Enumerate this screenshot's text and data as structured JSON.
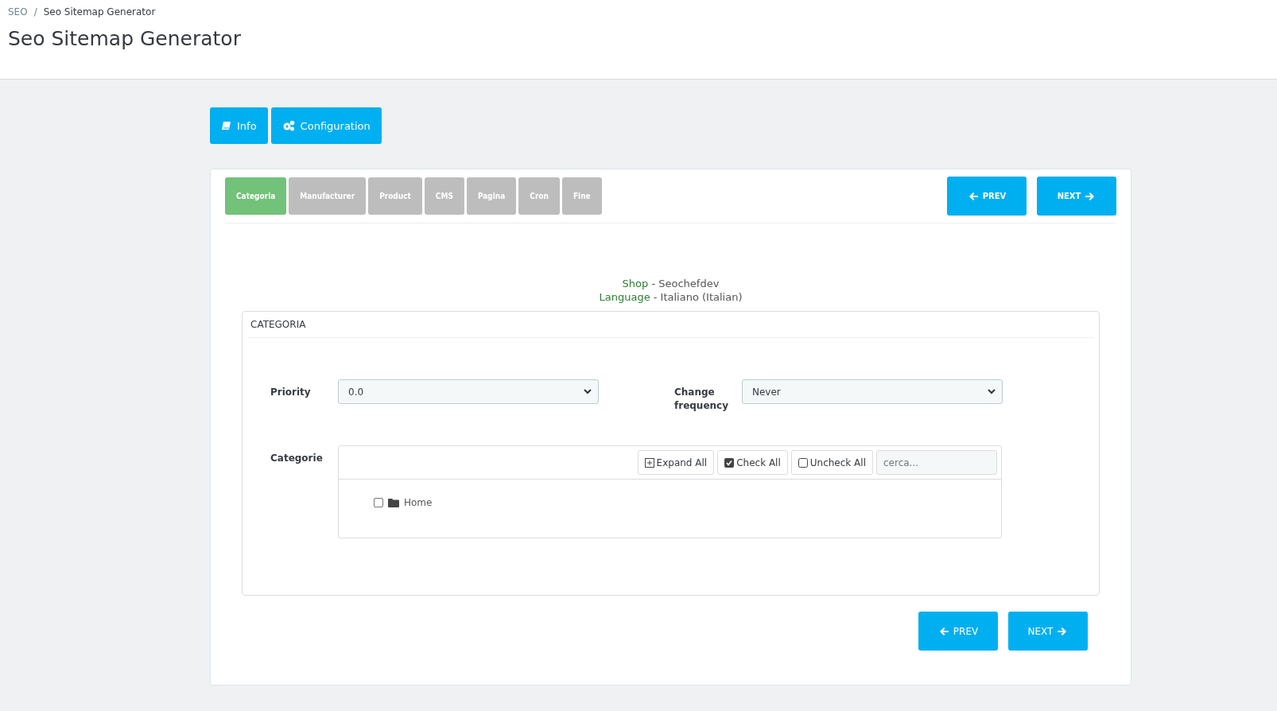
{
  "breadcrumb": {
    "items": [
      "SEO",
      "Seo Sitemap Generator"
    ],
    "separator": "/"
  },
  "title": "Seo Sitemap Generator",
  "toolbar": [
    {
      "label": "Info",
      "kind": "book"
    },
    {
      "label": "Configuration",
      "kind": "gears"
    }
  ],
  "steps": [
    {
      "label": "Categoria",
      "selected": true
    },
    {
      "label": "Manufacturer",
      "selected": false
    },
    {
      "label": "Product",
      "selected": false
    },
    {
      "label": "CMS",
      "selected": false
    },
    {
      "label": "Pagina",
      "selected": false
    },
    {
      "label": "Cron",
      "selected": false
    },
    {
      "label": "Fine",
      "selected": false
    }
  ],
  "nav_top": {
    "prev": "PREV",
    "next": "NEXT"
  },
  "info": [
    {
      "key": "Shop",
      "value": " - Seochefdev"
    },
    {
      "key": "Language",
      "value": " - Italiano (Italian)"
    }
  ],
  "section": {
    "title": "CATEGORIA",
    "priority": {
      "label": "Priority",
      "value": "0.0"
    },
    "frequency": {
      "label": "Change frequency",
      "value": "Never"
    },
    "tree": {
      "label": "Categorie",
      "actions": [
        {
          "label": "Expand All",
          "kind": "expand"
        },
        {
          "label": "Check All",
          "kind": "check"
        },
        {
          "label": "Uncheck All",
          "kind": "uncheck"
        }
      ],
      "search": {
        "placeholder": "cerca..."
      },
      "items": [
        {
          "label": "Home",
          "checked": false
        }
      ]
    }
  },
  "nav_bottom": {
    "prev": "PREV",
    "next": "NEXT"
  }
}
